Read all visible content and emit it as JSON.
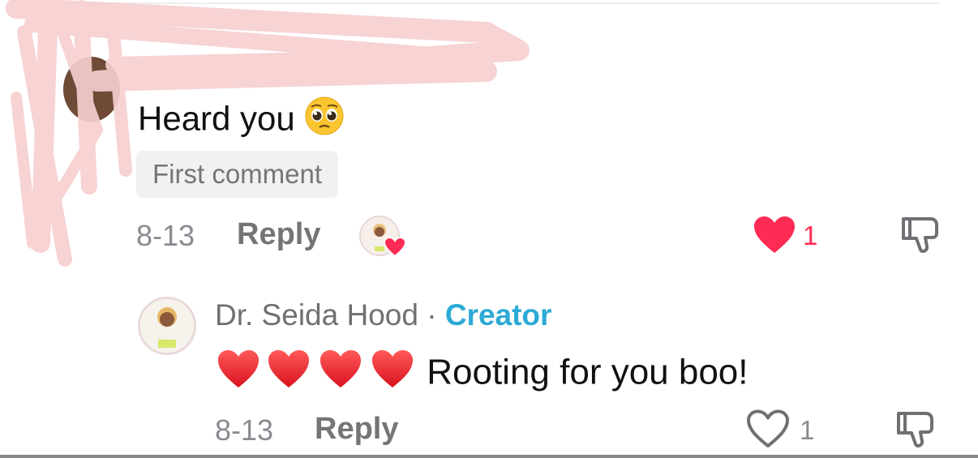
{
  "comment": {
    "text": "Heard you",
    "emoji": "pleading-face-emoji",
    "badge": "First comment",
    "date": "8-13",
    "reply_label": "Reply",
    "like_count": "1",
    "liked": true
  },
  "reply": {
    "author": "Dr. Seida Hood",
    "separator": "·",
    "role": "Creator",
    "text": "Rooting for you boo!",
    "emoji": "red-heart-emoji",
    "date": "8-13",
    "reply_label": "Reply",
    "like_count": "1",
    "liked": false
  },
  "colors": {
    "like_red": "#fe2c55",
    "creator_blue": "#2caad5",
    "muted": "#8a8b91"
  }
}
